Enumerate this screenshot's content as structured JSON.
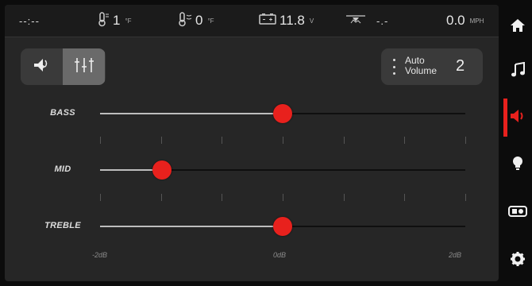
{
  "status_bar": {
    "compass": "--:--",
    "temp_inside_value": "1",
    "temp_inside_unit": "°F",
    "temp_outside_value": "0",
    "temp_outside_unit": "°F",
    "battery_value": "11.8",
    "battery_unit": "V",
    "altitude_value": "-.-",
    "speed_value": "0.0",
    "speed_unit": "MPH"
  },
  "controls": {
    "auto_volume_label_line1": "Auto",
    "auto_volume_label_line2": "Volume",
    "auto_volume_value": "2"
  },
  "equalizer": {
    "bands": [
      {
        "label": "BASS",
        "level": 0.5
      },
      {
        "label": "MID",
        "level": 0.17
      },
      {
        "label": "TREBLE",
        "level": 0.5
      }
    ],
    "scale": [
      "-2dB",
      "0dB",
      "2dB"
    ]
  },
  "nav": {
    "items": [
      "home-icon",
      "music-icon",
      "audio-settings-icon",
      "light-icon",
      "camera-icon",
      "settings-icon"
    ],
    "active": "audio-settings-icon"
  },
  "colors": {
    "accent": "#e8211d",
    "background": "#262626",
    "track_filled": "#bdbdbd"
  }
}
